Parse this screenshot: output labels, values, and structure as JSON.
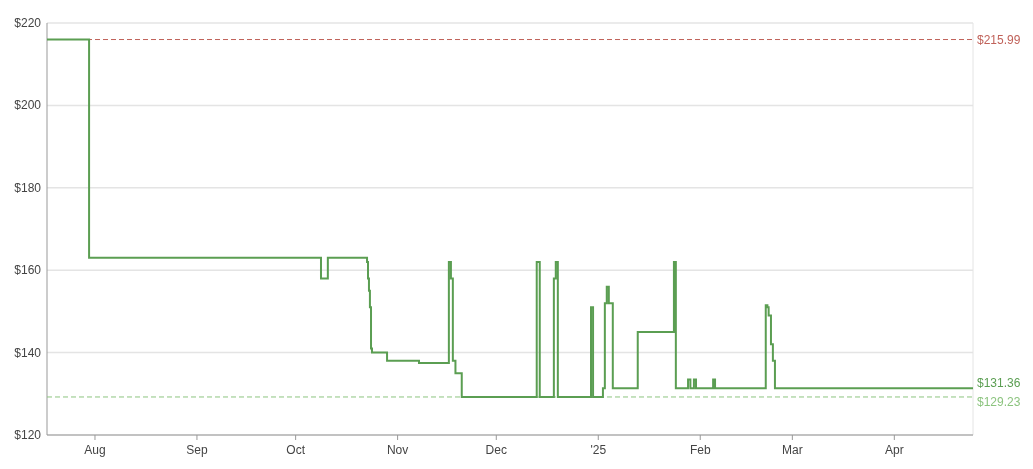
{
  "chart_data": {
    "type": "line",
    "grid": true,
    "x": [
      "2024-07-17T10:00",
      "2024-07-30T05:00",
      "2024-07-30T05:00",
      "2024-10-08T17:00",
      "2024-10-08T17:00",
      "2024-10-10T19:00",
      "2024-10-10T19:00",
      "2024-10-22T17:00",
      "2024-10-22T17:00",
      "2024-10-23T00:00",
      "2024-10-23T00:00",
      "2024-10-23T07:00",
      "2024-10-23T07:00",
      "2024-10-23T14:00",
      "2024-10-23T14:00",
      "2024-10-23T22:00",
      "2024-10-23T22:00",
      "2024-10-24T05:00",
      "2024-10-24T05:00",
      "2024-10-28T19:00",
      "2024-10-28T19:00",
      "2024-11-07T12:00",
      "2024-11-07T12:00",
      "2024-11-16T14:00",
      "2024-11-16T14:00",
      "2024-11-17T05:00",
      "2024-11-17T05:00",
      "2024-11-17T19:00",
      "2024-11-17T19:00",
      "2024-11-18T14:00",
      "2024-11-18T14:00",
      "2024-11-20T12:00",
      "2024-11-20T12:00",
      "2024-12-13T07:00",
      "2024-12-13T07:00",
      "2024-12-14T05:00",
      "2024-12-14T05:00",
      "2024-12-18T12:00",
      "2024-12-18T12:00",
      "2024-12-19T02:00",
      "2024-12-19T02:00",
      "2024-12-19T17:00",
      "2024-12-19T17:00",
      "2024-12-29T19:00",
      "2024-12-29T19:00",
      "2024-12-30T10:00",
      "2024-12-30T10:00",
      "2025-01-02T10:00",
      "2025-01-02T10:00",
      "2025-01-03T00:00",
      "2025-01-03T00:00",
      "2025-01-03T14:00",
      "2025-01-03T14:00",
      "2025-01-04T05:00",
      "2025-01-04T05:00",
      "2025-01-05T10:00",
      "2025-01-05T10:00",
      "2025-01-13T00:00",
      "2025-01-13T00:00",
      "2025-01-24T00:00",
      "2025-01-24T00:00",
      "2025-01-24T14:00",
      "2025-01-24T14:00",
      "2025-01-28T07:00",
      "2025-01-28T07:00",
      "2025-01-29T00:00",
      "2025-01-29T00:00",
      "2025-01-30T02:00",
      "2025-01-30T02:00",
      "2025-01-30T17:00",
      "2025-01-30T17:00",
      "2025-02-04T22:00",
      "2025-02-04T22:00",
      "2025-02-05T12:00",
      "2025-02-05T12:00",
      "2025-02-20T22:00",
      "2025-02-20T22:00",
      "2025-02-21T10:00",
      "2025-02-21T10:00",
      "2025-02-21T19:00",
      "2025-02-21T19:00",
      "2025-02-22T12:00",
      "2025-02-22T12:00",
      "2025-02-23T02:00",
      "2025-02-23T02:00",
      "2025-02-23T17:00",
      "2025-02-23T17:00",
      "2025-04-24T22:00"
    ],
    "series": [
      {
        "color": "#5b9e52",
        "values": [
          215.99,
          215.99,
          163,
          163,
          158,
          158,
          163,
          163,
          162,
          162,
          158,
          158,
          155,
          155,
          151,
          151,
          141,
          141,
          140,
          140,
          138,
          138,
          137.5,
          137.5,
          162,
          162,
          158,
          158,
          138,
          138,
          135,
          135,
          129.23,
          129.23,
          162,
          162,
          129.23,
          129.23,
          158,
          158,
          162,
          162,
          129.23,
          129.23,
          151,
          151,
          129.23,
          129.23,
          131.36,
          131.36,
          152,
          152,
          156,
          156,
          152,
          152,
          131.36,
          131.36,
          145,
          145,
          162,
          162,
          131.36,
          131.36,
          133.5,
          133.5,
          131.36,
          131.36,
          133.5,
          133.5,
          131.36,
          131.36,
          133.5,
          133.5,
          131.36,
          131.36,
          151.5,
          151.5,
          151,
          151,
          149,
          149,
          142,
          142,
          138,
          138,
          131.36,
          131.36
        ]
      }
    ],
    "xlim": [
      "2024-07-17T10:00",
      "2025-04-24T22:00"
    ],
    "ylim": [
      120,
      220
    ],
    "xticks": [
      {
        "value": "2024-08-01",
        "label": "Aug"
      },
      {
        "value": "2024-09-01",
        "label": "Sep"
      },
      {
        "value": "2024-10-01",
        "label": "Oct"
      },
      {
        "value": "2024-11-01",
        "label": "Nov"
      },
      {
        "value": "2024-12-01",
        "label": "Dec"
      },
      {
        "value": "2025-01-01",
        "label": "'25"
      },
      {
        "value": "2025-02-01",
        "label": "Feb"
      },
      {
        "value": "2025-03-01",
        "label": "Mar"
      },
      {
        "value": "2025-04-01",
        "label": "Apr"
      }
    ],
    "yticks": [
      {
        "value": 120,
        "label": "$120"
      },
      {
        "value": 140,
        "label": "$140"
      },
      {
        "value": 160,
        "label": "$160"
      },
      {
        "value": 180,
        "label": "$180"
      },
      {
        "value": 200,
        "label": "$200"
      },
      {
        "value": 220,
        "label": "$220"
      }
    ],
    "ref_lines": [
      {
        "axis": "y",
        "value": 215.99,
        "label": "$215.99",
        "color": "#c0625a"
      },
      {
        "axis": "y",
        "value": 129.23,
        "label": "$129.23",
        "color": "#8cc47f"
      }
    ],
    "annotations": [
      {
        "text": "$131.36",
        "x": "2025-04-24T22:00",
        "y": 131.36
      }
    ]
  }
}
